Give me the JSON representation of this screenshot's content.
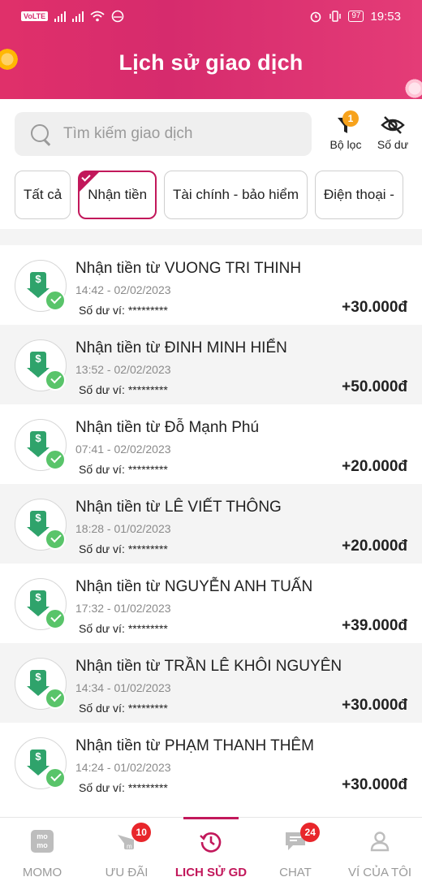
{
  "status_bar": {
    "carrier_badge": "VoLTE",
    "time": "19:53",
    "battery": "97"
  },
  "header": {
    "title": "Lịch sử giao dịch"
  },
  "search": {
    "placeholder": "Tìm kiếm giao dịch"
  },
  "tools": {
    "filter_label": "Bộ lọc",
    "filter_badge": "1",
    "balance_label": "Số dư"
  },
  "chips": [
    {
      "label": "Tất cả",
      "active": false
    },
    {
      "label": "Nhận tiền",
      "active": true
    },
    {
      "label": "Tài chính - bảo hiểm",
      "active": false
    },
    {
      "label": "Điện thoại - ",
      "active": false
    }
  ],
  "transactions": [
    {
      "title": "Nhận tiền từ VUONG TRI THINH",
      "time": "14:42 - 02/02/2023",
      "balance_label": "Số dư ví:",
      "balance_value": "*********",
      "amount": "+30.000đ"
    },
    {
      "title": "Nhận tiền từ ĐINH MINH HIỂN",
      "time": "13:52 - 02/02/2023",
      "balance_label": "Số dư ví:",
      "balance_value": "*********",
      "amount": "+50.000đ"
    },
    {
      "title": "Nhận tiền từ Đỗ Mạnh Phú",
      "time": "07:41 - 02/02/2023",
      "balance_label": "Số dư ví:",
      "balance_value": "*********",
      "amount": "+20.000đ"
    },
    {
      "title": "Nhận tiền từ LÊ VIẾT THÔNG",
      "time": "18:28 - 01/02/2023",
      "balance_label": "Số dư ví:",
      "balance_value": "*********",
      "amount": "+20.000đ"
    },
    {
      "title": "Nhận tiền từ NGUYỄN ANH TUẤN",
      "time": "17:32 - 01/02/2023",
      "balance_label": "Số dư ví:",
      "balance_value": "*********",
      "amount": "+39.000đ"
    },
    {
      "title": "Nhận tiền từ TRẦN LÊ KHÔI NGUYÊN",
      "time": "14:34 - 01/02/2023",
      "balance_label": "Số dư ví:",
      "balance_value": "*********",
      "amount": "+30.000đ"
    },
    {
      "title": "Nhận tiền từ PHẠM THANH THÊM",
      "time": "14:24 - 01/02/2023",
      "balance_label": "Số dư ví:",
      "balance_value": "*********",
      "amount": "+30.000đ"
    }
  ],
  "bottom_nav": [
    {
      "label": "MOMO",
      "icon": "momo-logo-icon",
      "badge": ""
    },
    {
      "label": "ƯU ĐÃI",
      "icon": "gift-icon",
      "badge": "10"
    },
    {
      "label": "LỊCH SỬ GD",
      "icon": "history-icon",
      "badge": "",
      "active": true
    },
    {
      "label": "CHAT",
      "icon": "chat-icon",
      "badge": "24"
    },
    {
      "label": "VÍ CỦA TÔI",
      "icon": "user-icon",
      "badge": ""
    }
  ],
  "colors": {
    "brand": "#d62b6d",
    "accent": "#c2185b",
    "success": "#59c46a",
    "badge": "#e8262b",
    "filter_badge": "#f7a21b"
  }
}
